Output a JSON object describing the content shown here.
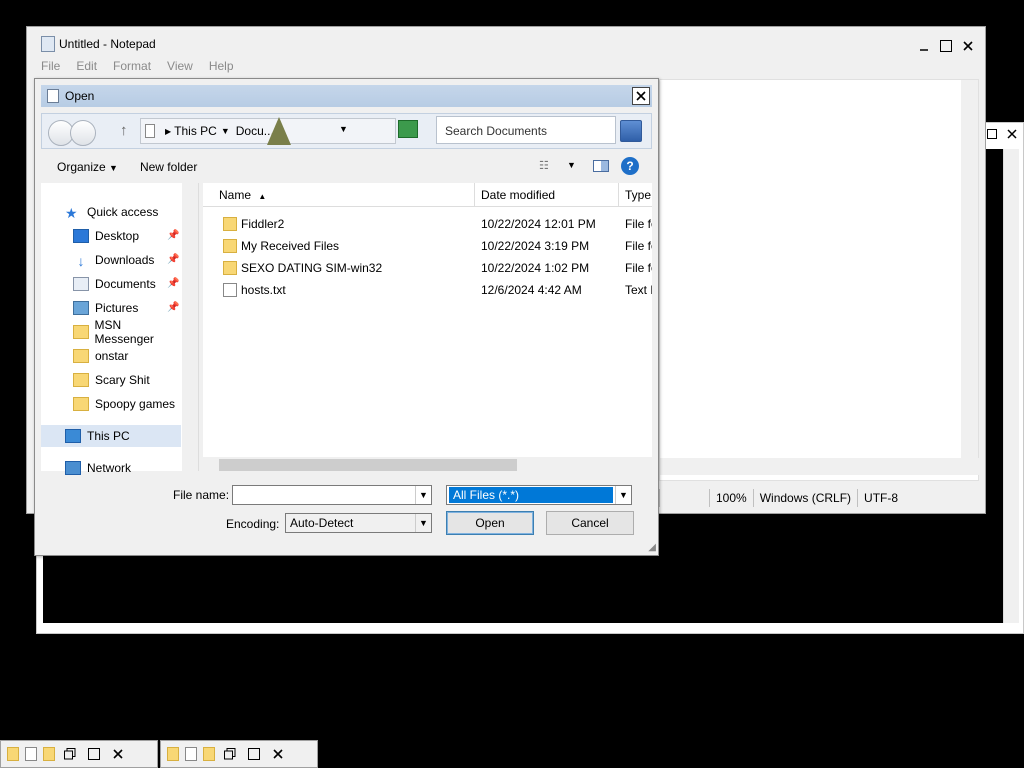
{
  "notepad": {
    "title": "Untitled - Notepad",
    "menu": [
      "File",
      "Edit",
      "Format",
      "View",
      "Help"
    ],
    "status": {
      "zoom": "100%",
      "line_ending": "Windows (CRLF)",
      "encoding": "UTF-8"
    }
  },
  "dialog": {
    "title": "Open",
    "address": {
      "root": "This PC",
      "folder": "Docu..."
    },
    "search_placeholder": "Search Documents",
    "toolbar": {
      "organize": "Organize",
      "new_folder": "New folder"
    },
    "nav_items": [
      {
        "label": "Quick access",
        "icon": "star-icon"
      },
      {
        "label": "Desktop",
        "icon": "desktop-icon",
        "pinned": true
      },
      {
        "label": "Downloads",
        "icon": "download-arrow-icon",
        "pinned": true
      },
      {
        "label": "Documents",
        "icon": "documents-icon",
        "pinned": true
      },
      {
        "label": "Pictures",
        "icon": "pictures-icon",
        "pinned": true
      },
      {
        "label": "MSN Messenger",
        "icon": "folder-icon"
      },
      {
        "label": "onstar",
        "icon": "folder-icon"
      },
      {
        "label": "Scary Shit",
        "icon": "folder-icon"
      },
      {
        "label": "Spoopy games",
        "icon": "folder-icon"
      },
      {
        "label": "This PC",
        "icon": "computer-icon"
      },
      {
        "label": "Network",
        "icon": "network-icon"
      }
    ],
    "columns": {
      "name": "Name",
      "date": "Date modified",
      "type": "Type"
    },
    "files": [
      {
        "name": "Fiddler2",
        "date": "10/22/2024 12:01 PM",
        "type": "File fo",
        "icon": "folder-icon"
      },
      {
        "name": "My Received Files",
        "date": "10/22/2024 3:19 PM",
        "type": "File fo",
        "icon": "folder-icon"
      },
      {
        "name": "SEXO DATING SIM-win32",
        "date": "10/22/2024 1:02 PM",
        "type": "File fo",
        "icon": "folder-icon"
      },
      {
        "name": "hosts.txt",
        "date": "12/6/2024 4:42 AM",
        "type": "Text D",
        "icon": "text-file-icon"
      }
    ],
    "file_name_label": "File name:",
    "file_name_value": "",
    "filter_value": "All Files  (*.*)",
    "encoding_label": "Encoding:",
    "encoding_value": "Auto-Detect",
    "open_label": "Open",
    "cancel_label": "Cancel"
  },
  "colors": {
    "selection": "#0078d7",
    "folder": "#f8d775",
    "nav_selected": "#dbe6f4"
  }
}
